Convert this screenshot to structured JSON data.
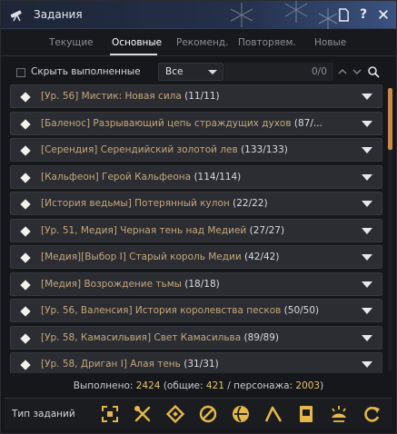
{
  "window": {
    "title": "Задания",
    "title_icon": "telescope-icon"
  },
  "titlebar_buttons": {
    "doc_icon": "document-icon",
    "help_label": "?",
    "close_icon": "pin-icon"
  },
  "tabs": [
    {
      "label": "Текущие",
      "active": false
    },
    {
      "label": "Основные",
      "active": true
    },
    {
      "label": "Рекоменд.",
      "active": false
    },
    {
      "label": "Повторяем.",
      "active": false
    },
    {
      "label": "Новые",
      "active": false
    }
  ],
  "filter": {
    "hide_completed_label": "Скрыть выполненные",
    "hide_completed_checked": false,
    "select_value": "Все",
    "counter": "0/0"
  },
  "quests": [
    {
      "name": "[Ур. 56] Мистик: Новая сила",
      "count": "(11/11)"
    },
    {
      "name": "[Баленос] Разрывающий цепь страждущих духов",
      "count": "(87/..."
    },
    {
      "name": "[Серендия] Серендийский золотой лев",
      "count": "(133/133)"
    },
    {
      "name": "[Кальфеон] Герой Кальфеона",
      "count": "(114/114)"
    },
    {
      "name": "[История ведьмы] Потерянный кулон",
      "count": "(22/22)"
    },
    {
      "name": "[Ур. 51, Медия] Черная тень над Медией",
      "count": "(27/27)"
    },
    {
      "name": "[Медия][Выбор I] Старый король Медии",
      "count": "(42/42)"
    },
    {
      "name": "[Медия] Возрождение тьмы",
      "count": "(18/18)"
    },
    {
      "name": "[Ур. 56, Валенсия] История королевства песков",
      "count": "(50/50)"
    },
    {
      "name": "[Ур. 58, Камасильвия] Свет Камасильва",
      "count": "(89/89)"
    },
    {
      "name": "[Ур. 58, Дриган I] Алая тень",
      "count": "(31/31)"
    }
  ],
  "summary": {
    "prefix": "Выполнено: ",
    "total": "2424",
    "mid1": " (общие: ",
    "common": "421",
    "mid2": " / персонажа: ",
    "character": "2003",
    "suffix": ")"
  },
  "bottom": {
    "type_label": "Тип заданий",
    "type_icons": [
      "frame-corners-icon",
      "crossed-tools-icon",
      "diamond-badge-icon",
      "leaf-slash-icon",
      "globe-icon",
      "pickaxe-icon",
      "book-icon",
      "weather-icon",
      "refresh-icon"
    ]
  },
  "colors": {
    "accent_gold": "#e3c56a",
    "quest_name": "#c6a77c",
    "scroll_thumb": "#c98b4a"
  }
}
